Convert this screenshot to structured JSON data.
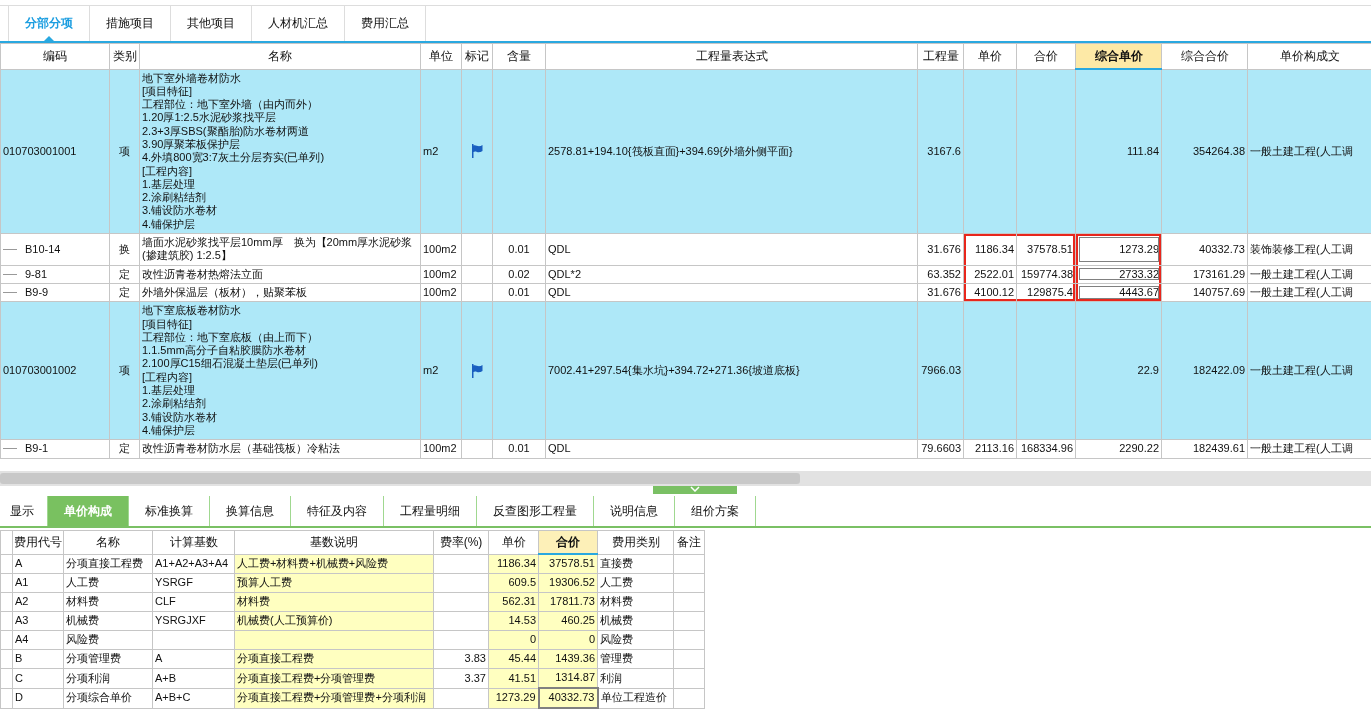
{
  "top_tabs": [
    {
      "label": "分部分项",
      "selected": true
    },
    {
      "label": "措施项目",
      "selected": false
    },
    {
      "label": "其他项目",
      "selected": false
    },
    {
      "label": "人材机汇总",
      "selected": false
    },
    {
      "label": "费用汇总",
      "selected": false
    }
  ],
  "top_table": {
    "columns": [
      {
        "label": "编码",
        "selected": false,
        "framed": false
      },
      {
        "label": "类别",
        "selected": false,
        "framed": false
      },
      {
        "label": "名称",
        "selected": false,
        "framed": false
      },
      {
        "label": "单位",
        "selected": false,
        "framed": false
      },
      {
        "label": "标记",
        "selected": false,
        "framed": false
      },
      {
        "label": "含量",
        "selected": false,
        "framed": false
      },
      {
        "label": "工程量表达式",
        "selected": false,
        "framed": false
      },
      {
        "label": "工程量",
        "selected": false,
        "framed": false
      },
      {
        "label": "单价",
        "selected": false,
        "framed": true
      },
      {
        "label": "合价",
        "selected": false,
        "framed": true
      },
      {
        "label": "综合单价",
        "selected": true,
        "framed": true
      },
      {
        "label": "综合合价",
        "selected": false,
        "framed": false
      },
      {
        "label": "单价构成文",
        "selected": false,
        "framed": false
      }
    ],
    "rows": [
      {
        "kind": "bill",
        "selected": false,
        "framed": false,
        "flagged": true,
        "code": "010703001001",
        "type": "项",
        "name": "地下室外墙卷材防水\n[项目特征]\n工程部位：地下室外墙（由内而外）\n1.20厚1:2.5水泥砂浆找平层\n2.3+3厚SBS(聚酯胎)防水卷材两道\n3.90厚聚苯板保护层\n4.外填800宽3:7灰土分层夯实(已单列)\n[工程内容]\n1.基层处理\n2.涂刷粘结剂\n3.铺设防水卷材\n4.铺保护层",
        "unit": "m2",
        "expression": "2578.81+194.10{筏板直面}+394.69{外墙外侧平面}",
        "quantity": "3167.6",
        "composite_price": "111.84",
        "composite_total": "354264.38",
        "template": "一般土建工程(人工调",
        "children": [
          {
            "kind": "quota",
            "selected": true,
            "framed": true,
            "flagged": false,
            "code": "B10-14",
            "type": "换",
            "name": "墙面水泥砂浆找平层10mm厚　换为【20mm厚水泥砂浆\n(掺建筑胶) 1:2.5】",
            "unit": "100m2",
            "content": "0.01",
            "expression": "QDL",
            "quantity": "31.676",
            "unit_price": "1186.34",
            "total": "37578.51",
            "composite_price": "1273.29",
            "composite_total": "40332.73",
            "template": "装饰装修工程(人工调"
          },
          {
            "kind": "quota",
            "selected": true,
            "framed": true,
            "flagged": false,
            "code": "9-81",
            "type": "定",
            "name": "改性沥青卷材热熔法立面",
            "unit": "100m2",
            "content": "0.02",
            "expression": "QDL*2",
            "quantity": "63.352",
            "unit_price": "2522.01",
            "total": "159774.38",
            "composite_price": "2733.32",
            "composite_total": "173161.29",
            "template": "一般土建工程(人工调"
          },
          {
            "kind": "quota",
            "selected": true,
            "framed": true,
            "flagged": false,
            "code": "B9-9",
            "type": "定",
            "name": "外墙外保温层（板材），贴聚苯板",
            "unit": "100m2",
            "content": "0.01",
            "expression": "QDL",
            "quantity": "31.676",
            "unit_price": "4100.12",
            "total": "129875.4",
            "composite_price": "4443.67",
            "composite_total": "140757.69",
            "template": "一般土建工程(人工调"
          }
        ]
      },
      {
        "kind": "bill",
        "selected": false,
        "framed": false,
        "flagged": true,
        "code": "010703001002",
        "type": "项",
        "name": "地下室底板卷材防水\n[项目特征]\n工程部位：地下室底板（由上而下）\n1.1.5mm高分子自粘胶膜防水卷材\n2.100厚C15细石混凝土垫层(已单列)\n[工程内容]\n1.基层处理\n2.涂刷粘结剂\n3.铺设防水卷材\n4.铺保护层",
        "unit": "m2",
        "expression": "7002.41+297.54{集水坑}+394.72+271.36{坡道底板}",
        "quantity": "7966.03",
        "composite_price": "22.9",
        "composite_total": "182422.09",
        "template": "一般土建工程(人工调",
        "children": [
          {
            "kind": "quota",
            "selected": false,
            "framed": false,
            "flagged": false,
            "code": "B9-1",
            "type": "定",
            "name": "改性沥青卷材防水层（基础筏板）冷粘法",
            "unit": "100m2",
            "content": "0.01",
            "expression": "QDL",
            "quantity": "79.6603",
            "unit_price": "2113.16",
            "total": "168334.96",
            "composite_price": "2290.22",
            "composite_total": "182439.61",
            "template": "一般土建工程(人工调"
          }
        ]
      }
    ]
  },
  "bottom_tabs": [
    {
      "label": "显示",
      "selected": false
    },
    {
      "label": "单价构成",
      "selected": true
    },
    {
      "label": "标准换算",
      "selected": false
    },
    {
      "label": "换算信息",
      "selected": false
    },
    {
      "label": "特征及内容",
      "selected": false
    },
    {
      "label": "工程量明细",
      "selected": false
    },
    {
      "label": "反查图形工程量",
      "selected": false
    },
    {
      "label": "说明信息",
      "selected": false
    },
    {
      "label": "组价方案",
      "selected": false
    }
  ],
  "bottom_table": {
    "columns": [
      {
        "label": "费用代号",
        "selected": false,
        "highlight": false
      },
      {
        "label": "名称",
        "selected": false,
        "highlight": false
      },
      {
        "label": "计算基数",
        "selected": false,
        "highlight": false
      },
      {
        "label": "基数说明",
        "selected": false,
        "highlight": true
      },
      {
        "label": "费率(%)",
        "selected": false,
        "highlight": false
      },
      {
        "label": "单价",
        "selected": false,
        "highlight": true
      },
      {
        "label": "合价",
        "selected": true,
        "highlight": true
      },
      {
        "label": "费用类别",
        "selected": false,
        "highlight": false
      },
      {
        "label": "备注",
        "selected": false,
        "highlight": false
      }
    ],
    "rows": [
      {
        "selected": false,
        "code": "A",
        "name": "分项直接工程费",
        "base": "A1+A2+A3+A4",
        "base_desc": "人工费+材料费+机械费+风险费",
        "unit_price": "1186.34",
        "total": "37578.51",
        "category": "直接费"
      },
      {
        "selected": false,
        "code": "A1",
        "name": "人工费",
        "base": "YSRGF",
        "base_desc": "预算人工费",
        "unit_price": "609.5",
        "total": "19306.52",
        "category": "人工费"
      },
      {
        "selected": false,
        "code": "A2",
        "name": "材料费",
        "base": "CLF",
        "base_desc": "材料费",
        "unit_price": "562.31",
        "total": "17811.73",
        "category": "材料费"
      },
      {
        "selected": false,
        "code": "A3",
        "name": "机械费",
        "base": "YSRGJXF",
        "base_desc": "机械费(人工预算价)",
        "unit_price": "14.53",
        "total": "460.25",
        "category": "机械费"
      },
      {
        "selected": false,
        "code": "A4",
        "name": "风险费",
        "unit_price": "0",
        "total": "0",
        "category": "风险费"
      },
      {
        "selected": false,
        "code": "B",
        "name": "分项管理费",
        "base": "A",
        "base_desc": "分项直接工程费",
        "rate": "3.83",
        "unit_price": "45.44",
        "total": "1439.36",
        "category": "管理费"
      },
      {
        "selected": false,
        "code": "C",
        "name": "分项利润",
        "base": "A+B",
        "base_desc": "分项直接工程费+分项管理费",
        "rate": "3.37",
        "unit_price": "41.51",
        "total": "1314.87",
        "category": "利润"
      },
      {
        "selected": true,
        "code": "D",
        "name": "分项综合单价",
        "base": "A+B+C",
        "base_desc": "分项直接工程费+分项管理费+分项利润",
        "unit_price": "1273.29",
        "total": "40332.73",
        "category": "单位工程造价"
      }
    ]
  }
}
